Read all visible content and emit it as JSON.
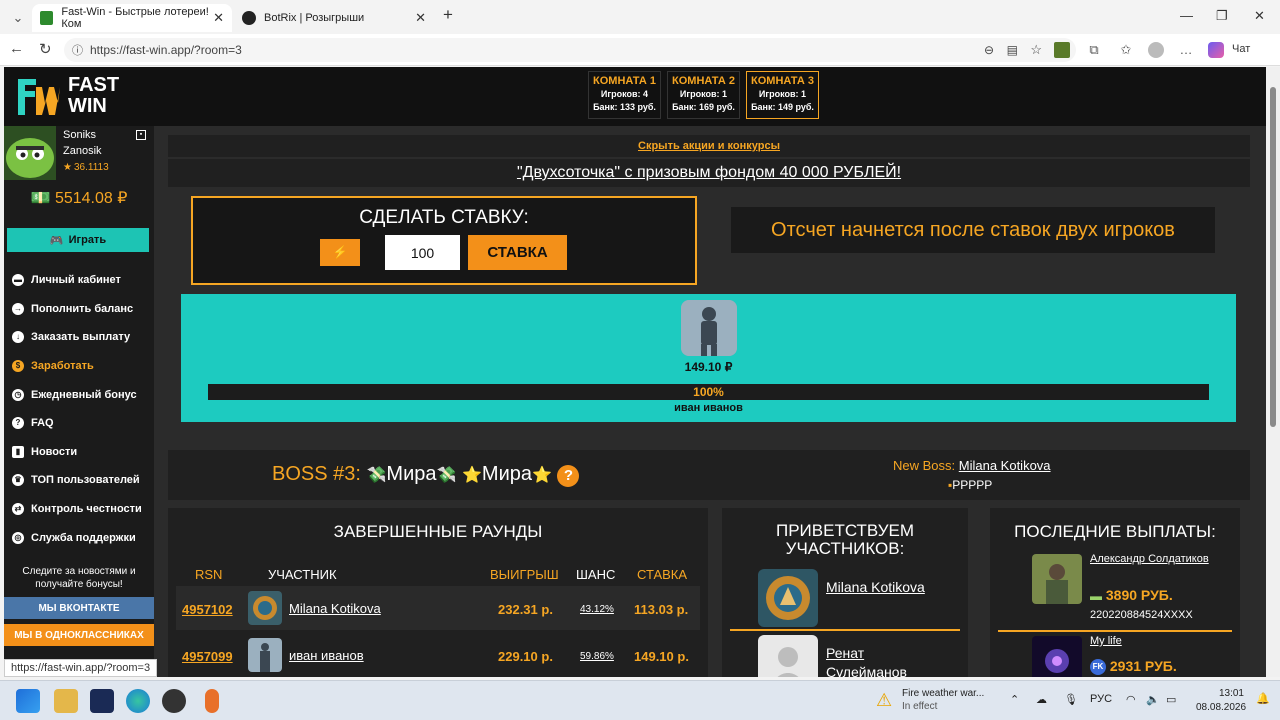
{
  "browser": {
    "tabs": [
      {
        "title": "Fast-Win - Быстрые лотереи! Ком",
        "active": true
      },
      {
        "title": "BotRix | Розыгрыши",
        "active": false
      }
    ],
    "url": "https://fast-win.app/?room=3",
    "chat_label": "Чат",
    "status_url": "https://fast-win.app/?room=3"
  },
  "site": {
    "logo_top": "FAST",
    "logo_bottom": "WIN",
    "rooms": [
      {
        "title": "КОМНАТА 1",
        "players": "Игроков: 4",
        "bank": "Банк: 133 руб.",
        "active": false
      },
      {
        "title": "КОМНАТА 2",
        "players": "Игроков: 1",
        "bank": "Банк: 169 руб.",
        "active": false
      },
      {
        "title": "КОМНАТА 3",
        "players": "Игроков: 1",
        "bank": "Банк: 149 руб.",
        "active": true
      }
    ],
    "user": {
      "first_name": "Soniks",
      "last_name": "Zanosik",
      "rating": "36.1113",
      "balance": "5514.08 ₽"
    },
    "play_label": "Играть",
    "menu": [
      {
        "label": "Личный кабинет",
        "icon": "wallet-icon"
      },
      {
        "label": "Пополнить баланс",
        "icon": "arrow-right-icon"
      },
      {
        "label": "Заказать выплату",
        "icon": "arrow-down-icon"
      },
      {
        "label": "Заработать",
        "icon": "money-icon"
      },
      {
        "label": "Ежедневный бонус",
        "icon": "clock-icon"
      },
      {
        "label": "FAQ",
        "icon": "question-icon"
      },
      {
        "label": "Новости",
        "icon": "bookmark-icon"
      },
      {
        "label": "ТОП пользователей",
        "icon": "trophy-icon"
      },
      {
        "label": "Контроль честности",
        "icon": "shuffle-icon"
      },
      {
        "label": "Служба поддержки",
        "icon": "globe-icon"
      }
    ],
    "follow_text": "Следите за новостями и получайте бонусы!",
    "social": {
      "vk": "МЫ ВКОНТАКТЕ",
      "ok": "МЫ В ОДНОКЛАССНИКАХ"
    },
    "hide_promos": "Скрыть акции и конкурсы",
    "promo": "\"Двухсоточка\" с призовым фондом 40 000 РУБЛЕЙ!",
    "bet": {
      "heading": "СДЕЛАТЬ СТАВКУ:",
      "value": "100",
      "button": "СТАВКА"
    },
    "countdown": "Отсчет начнется после ставок двух игроков",
    "arena": {
      "amount": "149.10 ₽",
      "progress_label": "100%",
      "progress": 1.0,
      "player": "иван иванов"
    },
    "boss": {
      "prefix": "BOSS #3:",
      "name1": "Мира",
      "name2": "Мира",
      "new_boss_label": "New Boss:",
      "new_boss_name": "Milana Kotikova",
      "flag_text": "РРРРР"
    },
    "rounds": {
      "title": "ЗАВЕРШЕННЫЕ РАУНДЫ",
      "headers": [
        "RSN",
        "УЧАСТНИК",
        "ВЫИГРЫШ",
        "ШАНС",
        "СТАВКА"
      ],
      "rows": [
        {
          "id": "4957102",
          "name": "Milana Kotikova",
          "win": "232.31 р.",
          "chance": "43.12%",
          "bet": "113.03 р."
        },
        {
          "id": "4957099",
          "name": "иван иванов",
          "win": "229.10 р.",
          "chance": "59.86%",
          "bet": "149.10 р."
        }
      ]
    },
    "welcome": {
      "title": "ПРИВЕТСТВУЕМ УЧАСТНИКОВ:",
      "users": [
        {
          "name": "Milana Kotikova"
        },
        {
          "name": "Ренат Сулейманов"
        }
      ]
    },
    "payouts": {
      "title": "ПОСЛЕДНИЕ ВЫПЛАТЫ:",
      "items": [
        {
          "name": "Александр Солдатиков",
          "amount": "3890 РУБ.",
          "card": "220220884524XXXX"
        },
        {
          "name": "My life",
          "amount": "2931 РУБ.",
          "card": ""
        }
      ]
    }
  },
  "taskbar": {
    "weather_title": "Fire weather war...",
    "weather_sub": "In effect",
    "lang": "РУС",
    "time": "13:01",
    "date": "08.08.2026"
  },
  "colors": {
    "accent": "#f6a623",
    "teal": "#1dcbc0",
    "dark": "#2b2b2b"
  }
}
